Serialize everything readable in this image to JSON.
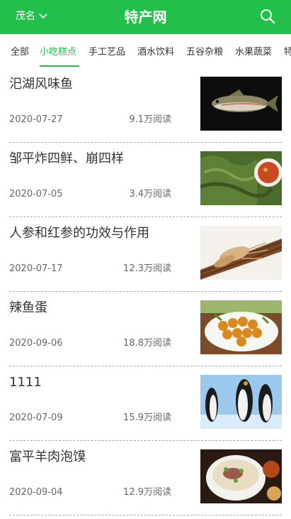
{
  "header": {
    "city": "茂名",
    "title": "特产网"
  },
  "tabs": [
    {
      "label": "全部"
    },
    {
      "label": "小吃糕点",
      "active": true
    },
    {
      "label": "手工艺品"
    },
    {
      "label": "酒水饮料"
    },
    {
      "label": "五谷杂粮"
    },
    {
      "label": "水果蔬菜"
    },
    {
      "label": "特"
    }
  ],
  "articles": [
    {
      "title": "汜湖风味鱼",
      "date": "2020-07-27",
      "reads": "9.1万阅读",
      "image": "fish-photo"
    },
    {
      "title": "邹平炸四鲜、崩四样",
      "date": "2020-07-05",
      "reads": "3.4万阅读",
      "image": "greens-dish-photo"
    },
    {
      "title": "人参和红参的功效与作用",
      "date": "2020-07-17",
      "reads": "12.3万阅读",
      "image": "ginseng-photo"
    },
    {
      "title": "辣鱼蛋",
      "date": "2020-09-06",
      "reads": "18.8万阅读",
      "image": "fish-balls-photo"
    },
    {
      "title": "1111",
      "date": "2020-07-09",
      "reads": "15.9万阅读",
      "image": "penguins-photo"
    },
    {
      "title": "富平羊肉泡馍",
      "date": "2020-09-04",
      "reads": "12.9万阅读",
      "image": "mutton-soup-photo"
    }
  ],
  "colors": {
    "brand": "#22c04a",
    "text": "#333333",
    "meta": "#666666"
  }
}
